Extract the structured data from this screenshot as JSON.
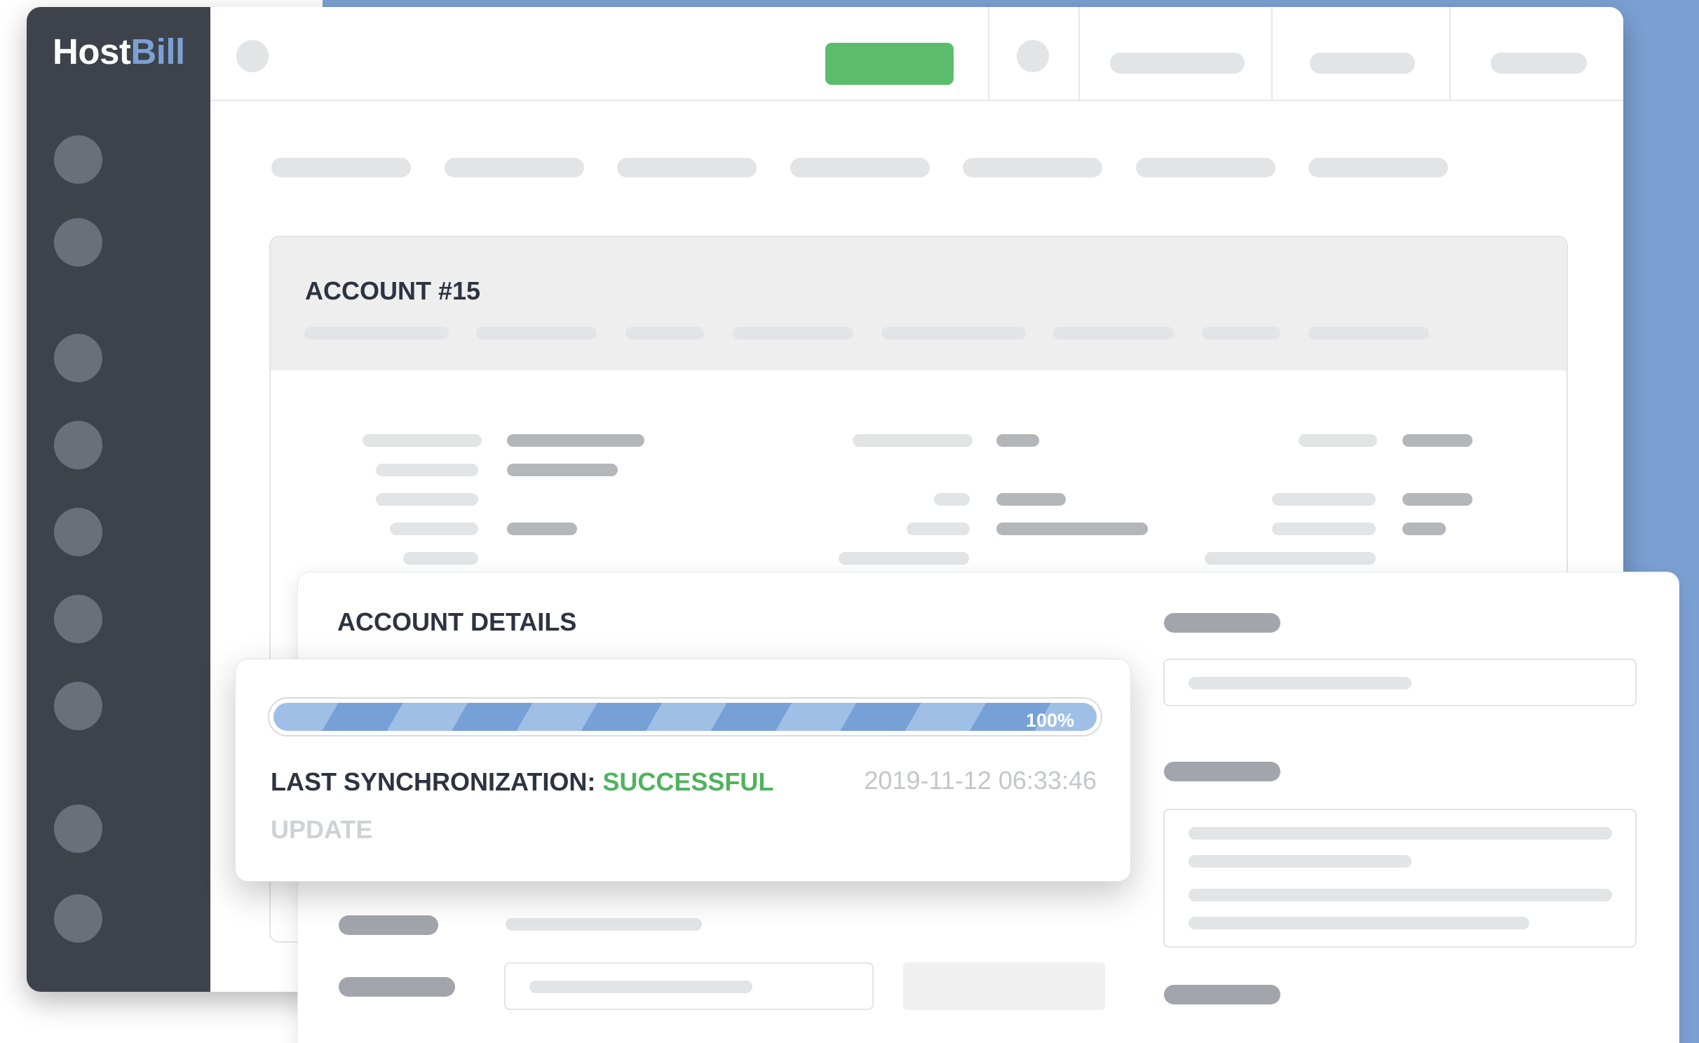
{
  "app": {
    "logo_primary": "Host",
    "logo_accent": "Bill"
  },
  "account": {
    "title": "ACCOUNT #15"
  },
  "details": {
    "title": "ACCOUNT DETAILS"
  },
  "sync": {
    "progress_percent": 100,
    "progress_label": "100%",
    "label": "LAST SYNCHRONIZATION:",
    "status": "SUCCESSFUL",
    "timestamp": "2019-11-12 06:33:46",
    "update_label": "UPDATE"
  },
  "colors": {
    "sidebar": "#3d424b",
    "accent_blue": "#7ba1d4",
    "success_green": "#4fb35d",
    "primary_button": "#5bbd6b"
  }
}
